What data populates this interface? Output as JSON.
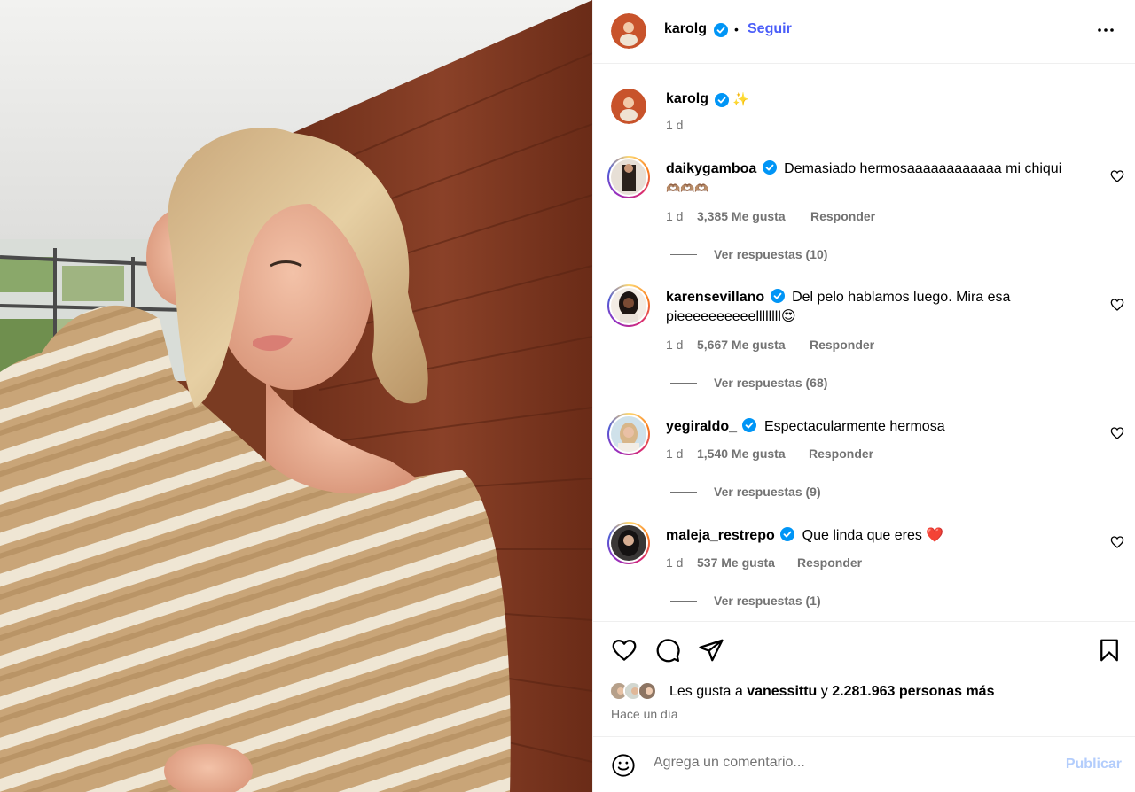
{
  "post": {
    "author": "karolg",
    "follow_label": "Seguir",
    "separator": "•",
    "caption_emoji": "✨",
    "caption_time": "1 d"
  },
  "comments": [
    {
      "user": "daikygamboa",
      "text": "Demasiado hermosaaaaaaaaaaaa mi chiqui",
      "text2": "🫶🏽🫶🏽🫶🏽",
      "time": "1 d",
      "likes": "3,385 Me gusta",
      "reply": "Responder",
      "view_replies": "Ver respuestas (10)"
    },
    {
      "user": "karensevillano",
      "text": "Del pelo hablamos luego. Mira esa",
      "text2": "pieeeeeeeeeellllllll😍",
      "time": "1 d",
      "likes": "5,667 Me gusta",
      "reply": "Responder",
      "view_replies": "Ver respuestas (68)"
    },
    {
      "user": "yegiraldo_",
      "text": "Espectacularmente hermosa",
      "time": "1 d",
      "likes": "1,540 Me gusta",
      "reply": "Responder",
      "view_replies": "Ver respuestas (9)"
    },
    {
      "user": "maleja_restrepo",
      "text": "Que linda que eres ❤️",
      "time": "1 d",
      "likes": "537 Me gusta",
      "reply": "Responder",
      "view_replies": "Ver respuestas (1)"
    }
  ],
  "likes": {
    "prefix": "Les gusta a",
    "user": "vanessittu",
    "connector": "y",
    "count": "2.281.963 personas más",
    "time": "Hace un día"
  },
  "comment_box": {
    "placeholder": "Agrega un comentario...",
    "publish_label": "Publicar"
  },
  "icons": [
    "heart-icon",
    "comment-icon",
    "share-icon",
    "bookmark-icon",
    "emoji-icon",
    "more-icon",
    "verified-icon"
  ],
  "colors": {
    "accent": "#4a5df9",
    "verified": "#0095f6",
    "muted": "#737373",
    "publish_disabled": "#b3cdfc"
  }
}
